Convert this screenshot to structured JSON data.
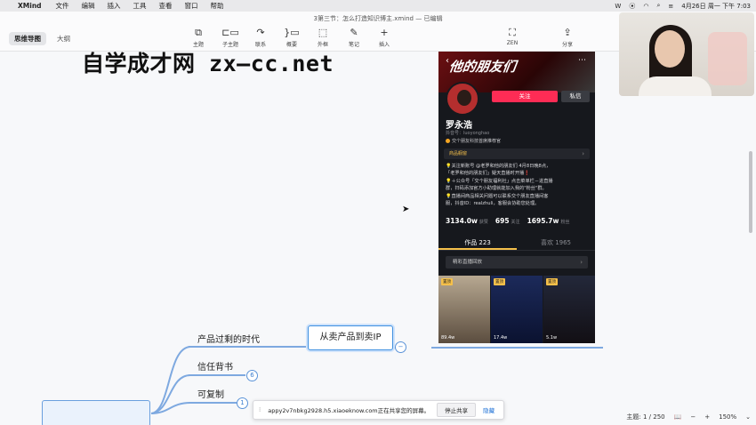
{
  "menubar": {
    "app": "XMind",
    "items": [
      "文件",
      "编辑",
      "插入",
      "工具",
      "查看",
      "窗口",
      "帮助"
    ],
    "clock": "4月26日 周一 下午 7:03"
  },
  "window": {
    "title": "3第三节：怎么打造知识博主.xmind — 已编辑",
    "view_tabs": [
      "思维导图",
      "大纲"
    ]
  },
  "toolbar": {
    "items": [
      {
        "label": "主题",
        "icon": "topic-icon"
      },
      {
        "label": "子主题",
        "icon": "subtopic-icon"
      },
      {
        "label": "联系",
        "icon": "relationship-icon"
      },
      {
        "label": "概要",
        "icon": "summary-icon"
      },
      {
        "label": "外框",
        "icon": "boundary-icon"
      },
      {
        "label": "笔记",
        "icon": "note-icon"
      },
      {
        "label": "插入",
        "icon": "plus-icon"
      },
      {
        "label": "ZEN",
        "icon": "zen-icon"
      },
      {
        "label": "分享",
        "icon": "share-icon"
      }
    ]
  },
  "watermark": "自学成才网 zx—cc.net",
  "profile": {
    "banner": "他的朋友们",
    "follow": "关注",
    "message": "私信",
    "name": "罗永浩",
    "account": "抖音号：luoyonghao",
    "tagline": "交个朋友科技首席推荐官",
    "shop": "商品橱窗",
    "bio": [
      "💡关注新账号 @老罗和他的朋友们 4月8日晚8点，",
      "「老罗和他的朋友们」疑天直播时开播❗",
      "💡＋公众号「交个朋友福利社」点击菜单栏－进直播",
      "群，扫码添加官方小助理就能加入我的\"粉丝\"群。",
      "💡直播间商品相关问题可以联系交个朋友直播间客",
      "服，抖音ID：realzhuli，客服会协助您处理。"
    ],
    "stats": [
      {
        "value": "3134.0w",
        "label": "获赞"
      },
      {
        "value": "695",
        "label": "关注"
      },
      {
        "value": "1695.7w",
        "label": "粉丝"
      }
    ],
    "tabs": [
      "作品 223",
      "喜欢 1965"
    ],
    "live_replay": "精彩直播回放",
    "thumbs": [
      {
        "pin": "置顶",
        "plays": "89.4w"
      },
      {
        "pin": "置顶",
        "plays": "17.4w"
      },
      {
        "pin": "置顶",
        "plays": "5.1w"
      }
    ]
  },
  "mindmap": {
    "center": "从卖产品到卖IP",
    "branches": [
      {
        "label": "产品过剩的时代"
      },
      {
        "label": "信任背书",
        "count": "6"
      },
      {
        "label": "可复制",
        "count": "1"
      }
    ]
  },
  "sharebar": {
    "text": "appy2v7nbkg2928.h5.xiaoeknow.com正在共享您的屏幕。",
    "stop": "停止共享",
    "hide": "隐藏"
  },
  "status": {
    "topics": "主题: 1 / 250",
    "zoom": "150%"
  }
}
